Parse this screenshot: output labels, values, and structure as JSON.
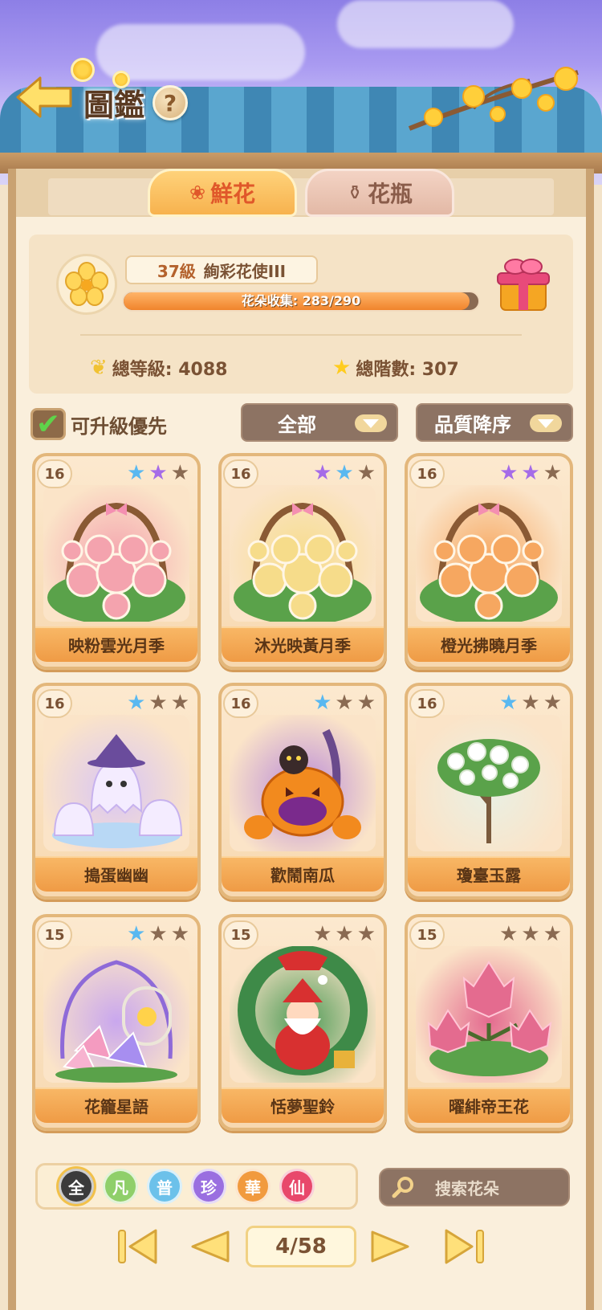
{
  "header": {
    "title": "圖鑑",
    "help_label": "?"
  },
  "tabs": [
    {
      "label": "鮮花",
      "active": true,
      "icon": "rose-icon"
    },
    {
      "label": "花瓶",
      "active": false,
      "icon": "vase-icon"
    }
  ],
  "profile": {
    "level": "37級",
    "rank_title": "絢彩花使III",
    "collection_text": "花朵收集: 283/290",
    "collected": 283,
    "total": 290,
    "total_level_text": "總等級: 4088",
    "total_stars_text": "總階數: 307"
  },
  "filters": {
    "upgrade_first_label": "可升級優先",
    "upgrade_first_checked": true,
    "category": "全部",
    "sort": "品質降序"
  },
  "cards": [
    {
      "level": "16",
      "name": "映粉雲光月季",
      "stars": [
        "blue",
        "purple",
        "empty"
      ],
      "art": "rose-arch",
      "tint": "#f4a3ae"
    },
    {
      "level": "16",
      "name": "沐光映黃月季",
      "stars": [
        "purple",
        "blue",
        "empty"
      ],
      "art": "rose-arch",
      "tint": "#f6dc8a"
    },
    {
      "level": "16",
      "name": "橙光拂曉月季",
      "stars": [
        "purple",
        "purple",
        "empty"
      ],
      "art": "rose-arch",
      "tint": "#f6a760"
    },
    {
      "level": "16",
      "name": "搗蛋幽幽",
      "stars": [
        "blue",
        "empty",
        "empty"
      ],
      "art": "ghosts",
      "tint": "#d8c5f5"
    },
    {
      "level": "16",
      "name": "歡鬧南瓜",
      "stars": [
        "blue",
        "empty",
        "empty"
      ],
      "art": "pumpkin",
      "tint": "#b98ad8"
    },
    {
      "level": "16",
      "name": "瓊臺玉露",
      "stars": [
        "blue",
        "empty",
        "empty"
      ],
      "art": "white-tree",
      "tint": "#e9f0e4"
    },
    {
      "level": "15",
      "name": "花籠星語",
      "stars": [
        "blue",
        "empty",
        "empty"
      ],
      "art": "cage",
      "tint": "#c9a7ee"
    },
    {
      "level": "15",
      "name": "恬夢聖鈴",
      "stars": [
        "empty",
        "empty",
        "empty"
      ],
      "art": "santa",
      "tint": "#4d9a55"
    },
    {
      "level": "15",
      "name": "曜緋帝王花",
      "stars": [
        "empty",
        "empty",
        "empty"
      ],
      "art": "protea",
      "tint": "#e46b8f"
    }
  ],
  "quality_buttons": [
    {
      "label": "全",
      "color": "#3b3b3b",
      "active": true
    },
    {
      "label": "凡",
      "color": "#8fcf6a",
      "active": false
    },
    {
      "label": "普",
      "color": "#6cc1ea",
      "active": false
    },
    {
      "label": "珍",
      "color": "#9a6fe0",
      "active": false
    },
    {
      "label": "華",
      "color": "#f19a3e",
      "active": false
    },
    {
      "label": "仙",
      "color": "#e8486b",
      "active": false
    }
  ],
  "search": {
    "placeholder": "搜索花朵"
  },
  "pagination": {
    "text": "4/58",
    "current": 4,
    "total": 58
  },
  "colors": {
    "accent": "#f0842c",
    "star_blue": "#59b8f0",
    "star_purple": "#a56be8",
    "star_empty": "#8a6a52"
  }
}
